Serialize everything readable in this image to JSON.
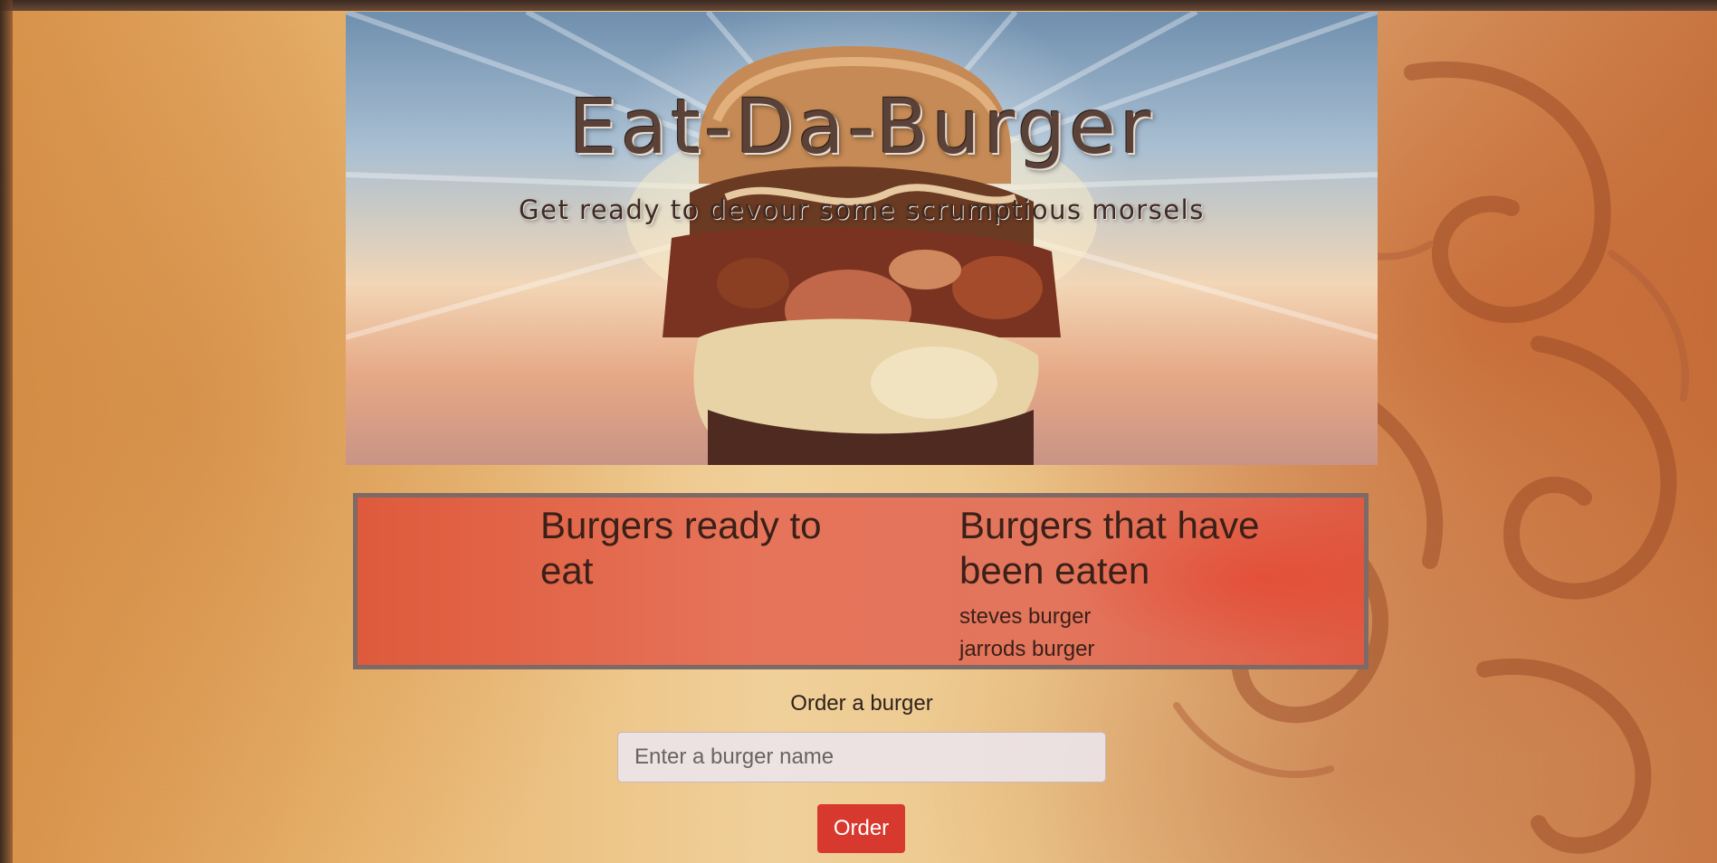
{
  "hero": {
    "title": "Eat-Da-Burger",
    "subtitle": "Get ready to devour some scrumptious morsels"
  },
  "burgers": {
    "ready_heading": "Burgers ready to eat",
    "ready_items": [],
    "eaten_heading": "Burgers that have been eaten",
    "eaten_items": [
      "steves burger",
      "jarrods burger"
    ]
  },
  "order_form": {
    "label": "Order a burger",
    "input_placeholder": "Enter a burger name",
    "input_value": "",
    "button_label": "Order"
  },
  "colors": {
    "panel_background": "#e2755c",
    "panel_border": "#7d6a66",
    "button_background": "#d8392f"
  }
}
